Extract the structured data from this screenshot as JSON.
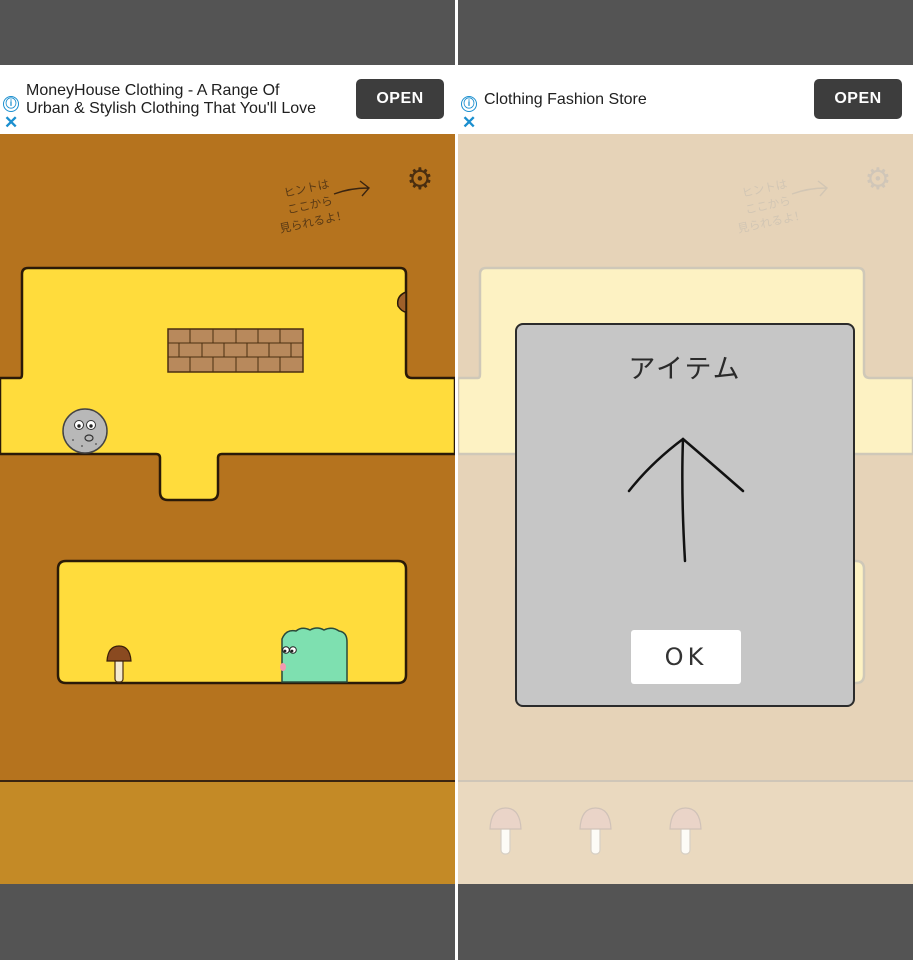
{
  "left_screen": {
    "ad": {
      "title": "MoneyHouse Clothing - A Range Of Urban & Stylish Clothing That You'll Love",
      "title_line1": "MoneyHouse Clothing - A Range Of",
      "title_line2": "Urban & Stylish Clothing That You'll Love",
      "button_label": "OPEN",
      "info_icon": "ⓘ",
      "close_icon": "✕"
    },
    "hint_text": {
      "line1": "ヒントは",
      "line2": "ここから",
      "line3": "見られるよ！"
    },
    "settings_icon": "gear-icon"
  },
  "right_screen": {
    "ad": {
      "title": "Clothing Fashion Store",
      "button_label": "OPEN",
      "info_icon": "ⓘ",
      "close_icon": "✕"
    },
    "hint_text": {
      "line1": "ヒントは",
      "line2": "ここから",
      "line3": "見られるよ！"
    },
    "dialog": {
      "title": "アイテム",
      "item_icon": "up-arrow-icon",
      "ok_label": "OK"
    },
    "inventory": [
      "mushroom-icon",
      "mushroom-icon",
      "mushroom-icon"
    ]
  },
  "colors": {
    "frame": "#545454",
    "dirt": "#b5731e",
    "tunnel": "#ffdc3c",
    "ground_strip": "#c48a26",
    "caterpillar": "#7ee0b0",
    "dialog_bg": "#c6c6c6",
    "ad_button": "#3d3d3d",
    "ad_icon": "#1b8fcf"
  }
}
